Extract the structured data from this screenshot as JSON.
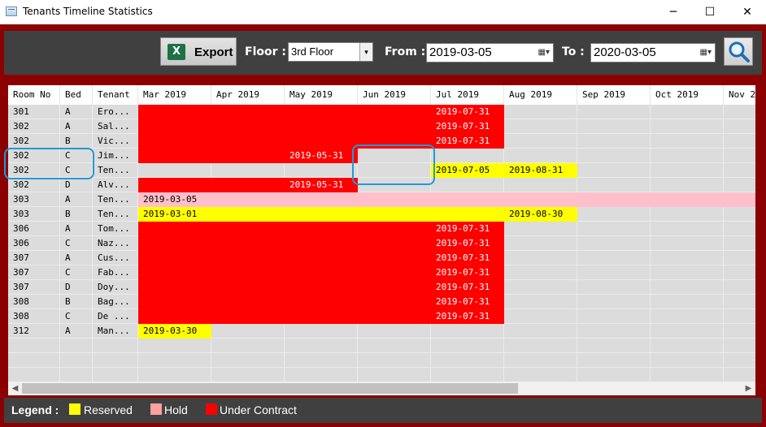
{
  "window": {
    "title": "Tenants Timeline Statistics",
    "min_glyph": "─",
    "max_glyph": "☐",
    "close_glyph": "✕"
  },
  "toolbar": {
    "export_label": "Export",
    "excel_icon_glyph": "X",
    "floor_label": "Floor :",
    "floor_value": "3rd Floor",
    "from_label": "From :",
    "from_value": "2019-03-05",
    "to_label": "To :",
    "to_value": "2020-03-05"
  },
  "grid": {
    "headers": [
      "Room No",
      "Bed",
      "Tenant",
      "Mar 2019",
      "Apr 2019",
      "May 2019",
      "Jun 2019",
      "Jul 2019",
      "Aug 2019",
      "Sep 2019",
      "Oct 2019",
      "Nov 2"
    ],
    "rows": [
      {
        "room": "301",
        "bed": "A",
        "tenant": "Ero...",
        "cells": [
          {
            "c": "red",
            "t": ""
          },
          {
            "c": "red",
            "t": ""
          },
          {
            "c": "red",
            "t": ""
          },
          {
            "c": "red",
            "t": ""
          },
          {
            "c": "red",
            "t": "2019-07-31"
          },
          {
            "c": "",
            "t": ""
          },
          {
            "c": "",
            "t": ""
          },
          {
            "c": "",
            "t": ""
          },
          {
            "c": "",
            "t": ""
          }
        ]
      },
      {
        "room": "302",
        "bed": "A",
        "tenant": "Sal...",
        "cells": [
          {
            "c": "red",
            "t": ""
          },
          {
            "c": "red",
            "t": ""
          },
          {
            "c": "red",
            "t": ""
          },
          {
            "c": "red",
            "t": ""
          },
          {
            "c": "red",
            "t": "2019-07-31"
          },
          {
            "c": "",
            "t": ""
          },
          {
            "c": "",
            "t": ""
          },
          {
            "c": "",
            "t": ""
          },
          {
            "c": "",
            "t": ""
          }
        ]
      },
      {
        "room": "302",
        "bed": "B",
        "tenant": "Vic...",
        "cells": [
          {
            "c": "red",
            "t": ""
          },
          {
            "c": "red",
            "t": ""
          },
          {
            "c": "red",
            "t": ""
          },
          {
            "c": "red",
            "t": ""
          },
          {
            "c": "red",
            "t": "2019-07-31"
          },
          {
            "c": "",
            "t": ""
          },
          {
            "c": "",
            "t": ""
          },
          {
            "c": "",
            "t": ""
          },
          {
            "c": "",
            "t": ""
          }
        ]
      },
      {
        "room": "302",
        "bed": "C",
        "tenant": "Jim...",
        "cells": [
          {
            "c": "red",
            "t": ""
          },
          {
            "c": "red",
            "t": ""
          },
          {
            "c": "red",
            "t": "2019-05-31"
          },
          {
            "c": "",
            "t": ""
          },
          {
            "c": "",
            "t": ""
          },
          {
            "c": "",
            "t": ""
          },
          {
            "c": "",
            "t": ""
          },
          {
            "c": "",
            "t": ""
          },
          {
            "c": "",
            "t": ""
          }
        ]
      },
      {
        "room": "302",
        "bed": "C",
        "tenant": "Ten...",
        "cells": [
          {
            "c": "",
            "t": ""
          },
          {
            "c": "",
            "t": ""
          },
          {
            "c": "",
            "t": ""
          },
          {
            "c": "",
            "t": ""
          },
          {
            "c": "yellow",
            "t": "2019-07-05"
          },
          {
            "c": "yellow",
            "t": "2019-08-31"
          },
          {
            "c": "",
            "t": ""
          },
          {
            "c": "",
            "t": ""
          },
          {
            "c": "",
            "t": ""
          }
        ]
      },
      {
        "room": "302",
        "bed": "D",
        "tenant": "Alv...",
        "cells": [
          {
            "c": "red",
            "t": ""
          },
          {
            "c": "red",
            "t": ""
          },
          {
            "c": "red",
            "t": "2019-05-31"
          },
          {
            "c": "",
            "t": ""
          },
          {
            "c": "",
            "t": ""
          },
          {
            "c": "",
            "t": ""
          },
          {
            "c": "",
            "t": ""
          },
          {
            "c": "",
            "t": ""
          },
          {
            "c": "",
            "t": ""
          }
        ]
      },
      {
        "room": "303",
        "bed": "A",
        "tenant": "Ten...",
        "cells": [
          {
            "c": "pink",
            "t": "2019-03-05"
          },
          {
            "c": "pink",
            "t": ""
          },
          {
            "c": "pink",
            "t": ""
          },
          {
            "c": "pink",
            "t": ""
          },
          {
            "c": "pink",
            "t": ""
          },
          {
            "c": "pink",
            "t": ""
          },
          {
            "c": "pink",
            "t": ""
          },
          {
            "c": "pink",
            "t": ""
          },
          {
            "c": "pink",
            "t": ""
          }
        ]
      },
      {
        "room": "303",
        "bed": "B",
        "tenant": "Ten...",
        "cells": [
          {
            "c": "yellow",
            "t": "2019-03-01"
          },
          {
            "c": "yellow",
            "t": ""
          },
          {
            "c": "yellow",
            "t": ""
          },
          {
            "c": "yellow",
            "t": ""
          },
          {
            "c": "yellow",
            "t": ""
          },
          {
            "c": "yellow",
            "t": "2019-08-30"
          },
          {
            "c": "",
            "t": ""
          },
          {
            "c": "",
            "t": ""
          },
          {
            "c": "",
            "t": ""
          }
        ]
      },
      {
        "room": "306",
        "bed": "A",
        "tenant": "Tom...",
        "cells": [
          {
            "c": "red",
            "t": ""
          },
          {
            "c": "red",
            "t": ""
          },
          {
            "c": "red",
            "t": ""
          },
          {
            "c": "red",
            "t": ""
          },
          {
            "c": "red",
            "t": "2019-07-31"
          },
          {
            "c": "",
            "t": ""
          },
          {
            "c": "",
            "t": ""
          },
          {
            "c": "",
            "t": ""
          },
          {
            "c": "",
            "t": ""
          }
        ]
      },
      {
        "room": "306",
        "bed": "C",
        "tenant": "Naz...",
        "cells": [
          {
            "c": "red",
            "t": ""
          },
          {
            "c": "red",
            "t": ""
          },
          {
            "c": "red",
            "t": ""
          },
          {
            "c": "red",
            "t": ""
          },
          {
            "c": "red",
            "t": "2019-07-31"
          },
          {
            "c": "",
            "t": ""
          },
          {
            "c": "",
            "t": ""
          },
          {
            "c": "",
            "t": ""
          },
          {
            "c": "",
            "t": ""
          }
        ]
      },
      {
        "room": "307",
        "bed": "A",
        "tenant": "Cus...",
        "cells": [
          {
            "c": "red",
            "t": ""
          },
          {
            "c": "red",
            "t": ""
          },
          {
            "c": "red",
            "t": ""
          },
          {
            "c": "red",
            "t": ""
          },
          {
            "c": "red",
            "t": "2019-07-31"
          },
          {
            "c": "",
            "t": ""
          },
          {
            "c": "",
            "t": ""
          },
          {
            "c": "",
            "t": ""
          },
          {
            "c": "",
            "t": ""
          }
        ]
      },
      {
        "room": "307",
        "bed": "C",
        "tenant": "Fab...",
        "cells": [
          {
            "c": "red",
            "t": ""
          },
          {
            "c": "red",
            "t": ""
          },
          {
            "c": "red",
            "t": ""
          },
          {
            "c": "red",
            "t": ""
          },
          {
            "c": "red",
            "t": "2019-07-31"
          },
          {
            "c": "",
            "t": ""
          },
          {
            "c": "",
            "t": ""
          },
          {
            "c": "",
            "t": ""
          },
          {
            "c": "",
            "t": ""
          }
        ]
      },
      {
        "room": "307",
        "bed": "D",
        "tenant": "Doy...",
        "cells": [
          {
            "c": "red",
            "t": ""
          },
          {
            "c": "red",
            "t": ""
          },
          {
            "c": "red",
            "t": ""
          },
          {
            "c": "red",
            "t": ""
          },
          {
            "c": "red",
            "t": "2019-07-31"
          },
          {
            "c": "",
            "t": ""
          },
          {
            "c": "",
            "t": ""
          },
          {
            "c": "",
            "t": ""
          },
          {
            "c": "",
            "t": ""
          }
        ]
      },
      {
        "room": "308",
        "bed": "B",
        "tenant": "Bag...",
        "cells": [
          {
            "c": "red",
            "t": ""
          },
          {
            "c": "red",
            "t": ""
          },
          {
            "c": "red",
            "t": ""
          },
          {
            "c": "red",
            "t": ""
          },
          {
            "c": "red",
            "t": "2019-07-31"
          },
          {
            "c": "",
            "t": ""
          },
          {
            "c": "",
            "t": ""
          },
          {
            "c": "",
            "t": ""
          },
          {
            "c": "",
            "t": ""
          }
        ]
      },
      {
        "room": "308",
        "bed": "C",
        "tenant": "De ...",
        "cells": [
          {
            "c": "red",
            "t": ""
          },
          {
            "c": "red",
            "t": ""
          },
          {
            "c": "red",
            "t": ""
          },
          {
            "c": "red",
            "t": ""
          },
          {
            "c": "red",
            "t": "2019-07-31"
          },
          {
            "c": "",
            "t": ""
          },
          {
            "c": "",
            "t": ""
          },
          {
            "c": "",
            "t": ""
          },
          {
            "c": "",
            "t": ""
          }
        ]
      },
      {
        "room": "312",
        "bed": "A",
        "tenant": "Man...",
        "cells": [
          {
            "c": "yellow",
            "t": "2019-03-30"
          },
          {
            "c": "",
            "t": ""
          },
          {
            "c": "",
            "t": ""
          },
          {
            "c": "",
            "t": ""
          },
          {
            "c": "",
            "t": ""
          },
          {
            "c": "",
            "t": ""
          },
          {
            "c": "",
            "t": ""
          },
          {
            "c": "",
            "t": ""
          },
          {
            "c": "",
            "t": ""
          }
        ]
      }
    ],
    "empty_rows": 3
  },
  "legend": {
    "title": "Legend :",
    "items": [
      {
        "label": "Reserved",
        "color": "#ffff00"
      },
      {
        "label": "Hold",
        "color": "#ffa0a0"
      },
      {
        "label": "Under Contract",
        "color": "#ff0000"
      }
    ]
  },
  "colors": {
    "frame": "#8b0000",
    "panel": "#404040",
    "under_contract": "#ff0000",
    "reserved": "#ffff00",
    "hold": "#ffc0cb",
    "annotation": "#1f9ad6"
  }
}
